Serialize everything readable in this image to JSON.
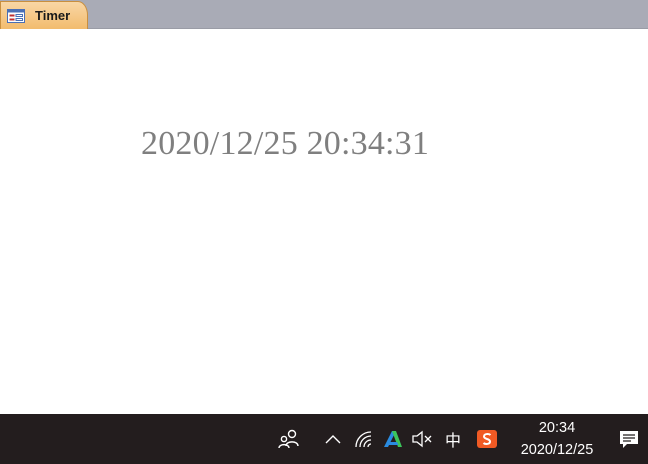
{
  "form": {
    "tab_label": "Timer",
    "datetime_display": "2020/12/25 20:34:31"
  },
  "taskbar": {
    "tray_icons": [
      "people-icon",
      "chevron-up-icon",
      "wifi-icon",
      "app-tray-icon",
      "volume-muted-icon",
      "ime-icon",
      "sogou-icon"
    ],
    "ime_label": "中",
    "clock_time": "20:34",
    "clock_date": "2020/12/25",
    "notification_icon": "action-center-icon"
  },
  "colors": {
    "tab_strip": "#a9abb6",
    "active_tab": "#f2bc6e",
    "clock_text": "#7f7f7f",
    "taskbar": "#231d1e"
  }
}
